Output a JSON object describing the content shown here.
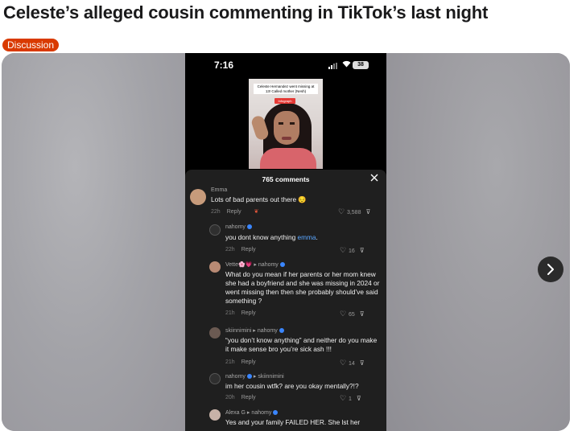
{
  "post": {
    "title": "Celeste’s alleged cousin commenting in TikTok’s last night",
    "flair": "Discussion"
  },
  "phone": {
    "time": "7:16",
    "battery": "38",
    "video_caption": "Celeste Hernandez went missing at 13! Called mother (Nesh)",
    "video_tag": "Infograph"
  },
  "comments_sheet": {
    "count_label": "765 comments",
    "close_icon": "close-icon",
    "comments": [
      {
        "user": "Emma",
        "text": "Lots of bad parents out there 😔",
        "age": "22h",
        "reply_label": "Reply",
        "likes": "3,588",
        "avatar_color": "#c79b7b"
      },
      {
        "user": "nahomy",
        "text_prefix": "you dont know anything ",
        "mention": "emma",
        "text_suffix": ".",
        "age": "22h",
        "reply_label": "Reply",
        "likes": "16",
        "avatar_color": "#3a3a3a"
      },
      {
        "user": "Vette🌸💗",
        "reply_to": "nahomy",
        "text": "What do you mean if her parents or her mom knew she had a boyfriend and she was missing in 2024 or went missing then then she probably should’ve said something ?",
        "age": "21h",
        "reply_label": "Reply",
        "likes": "65",
        "avatar_color": "#b88a74"
      },
      {
        "user": "skiinnimini",
        "reply_to": "nahomy",
        "text": "“you don’t know anything” and neither do you make it make sense bro you’re sick ash !!!",
        "age": "21h",
        "reply_label": "Reply",
        "likes": "14",
        "avatar_color": "#6b5a52"
      },
      {
        "user": "nahomy",
        "reply_to": "skiinnimini",
        "text": "im her cousin wtfk? are you okay mentally?!?",
        "age": "20h",
        "reply_label": "Reply",
        "likes": "1",
        "avatar_color": "#3a3a3a"
      },
      {
        "user": "Alexa G",
        "reply_to": "nahomy",
        "text": "Yes and your family FAILED HER. She lst her",
        "avatar_color": "#c8b2a8"
      }
    ]
  },
  "nav": {
    "next_icon": "chevron-right-icon"
  }
}
